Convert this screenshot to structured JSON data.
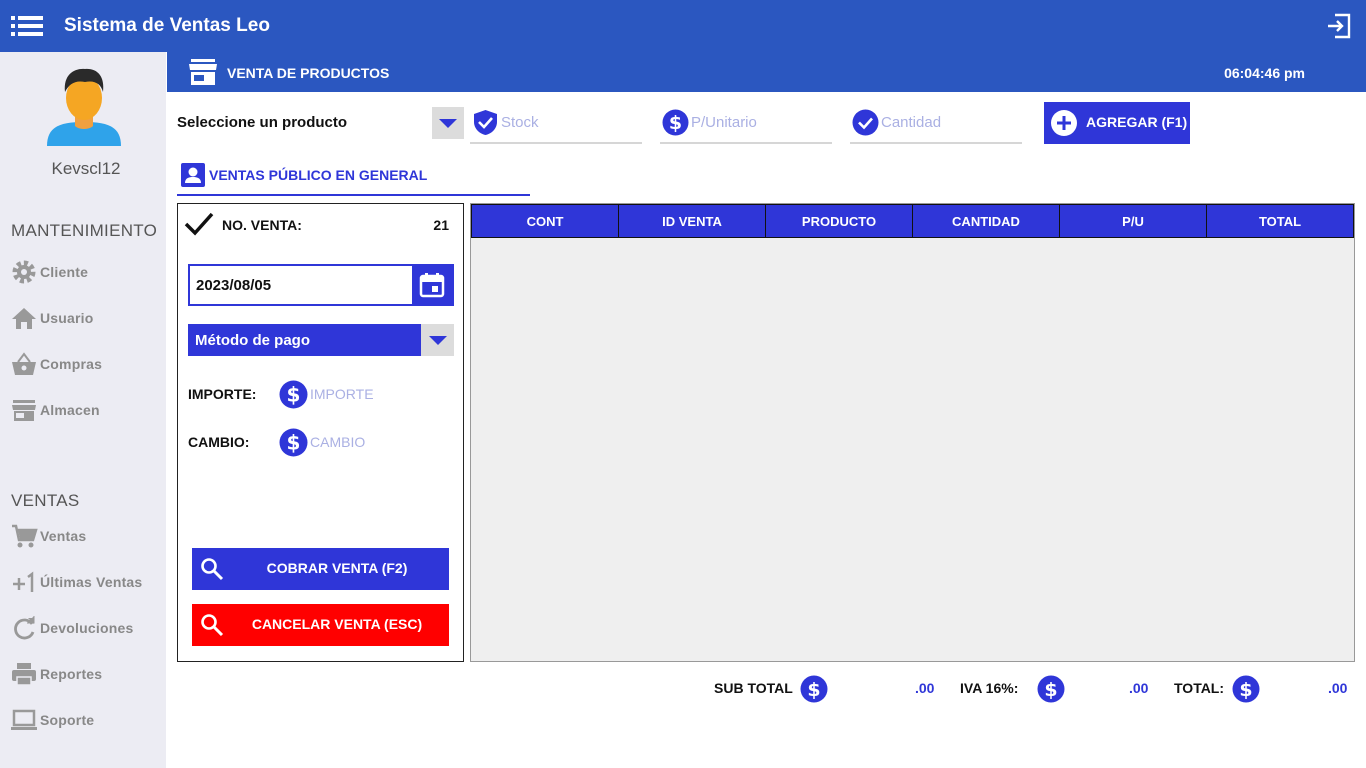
{
  "app": {
    "title": "Sistema de Ventas Leo"
  },
  "sidebar": {
    "username": "Kevscl12",
    "sections": {
      "mantenimiento": "MANTENIMIENTO",
      "ventas": "VENTAS"
    },
    "items": [
      {
        "label": "Cliente",
        "icon": "gear-icon"
      },
      {
        "label": "Usuario",
        "icon": "home-icon"
      },
      {
        "label": "Compras",
        "icon": "basket-icon"
      },
      {
        "label": "Almacen",
        "icon": "store-icon"
      },
      {
        "label": "Ventas",
        "icon": "cart-icon"
      },
      {
        "label": "Últimas Ventas",
        "icon": "plus-one-icon"
      },
      {
        "label": "Devoluciones",
        "icon": "refresh-icon"
      },
      {
        "label": "Reportes",
        "icon": "printer-icon"
      },
      {
        "label": "Soporte",
        "icon": "laptop-icon"
      }
    ]
  },
  "header": {
    "title": "VENTA DE PRODUCTOS",
    "clock": "06:04:46 pm"
  },
  "product_row": {
    "label": "Seleccione un producto",
    "stock_placeholder": "Stock",
    "price_placeholder": "P/Unitario",
    "qty_placeholder": "Cantidad",
    "add_button": "AGREGAR (F1)"
  },
  "tab": {
    "label": "VENTAS PÚBLICO EN GENERAL"
  },
  "sale_panel": {
    "sale_number_label": "NO. VENTA:",
    "sale_number": "21",
    "date": "2023/08/05",
    "payment_method": "Método de pago",
    "importe_label": "IMPORTE:",
    "importe_placeholder": "IMPORTE",
    "cambio_label": "CAMBIO:",
    "cambio_placeholder": "CAMBIO",
    "charge_button": "COBRAR VENTA (F2)",
    "cancel_button": "CANCELAR VENTA (ESC)"
  },
  "table": {
    "columns": [
      "CONT",
      "ID VENTA",
      "PRODUCTO",
      "CANTIDAD",
      "P/U",
      "TOTAL"
    ],
    "rows": []
  },
  "totals": {
    "subtotal_label": "SUB TOTAL",
    "subtotal_value": ".00",
    "iva_label": "IVA 16%:",
    "iva_value": ".00",
    "total_label": "TOTAL:",
    "total_value": ".00"
  },
  "colors": {
    "topbar": "#2b57c0",
    "accent": "#2f36d8",
    "danger": "#ff0000",
    "sidebar": "#ececf3"
  }
}
